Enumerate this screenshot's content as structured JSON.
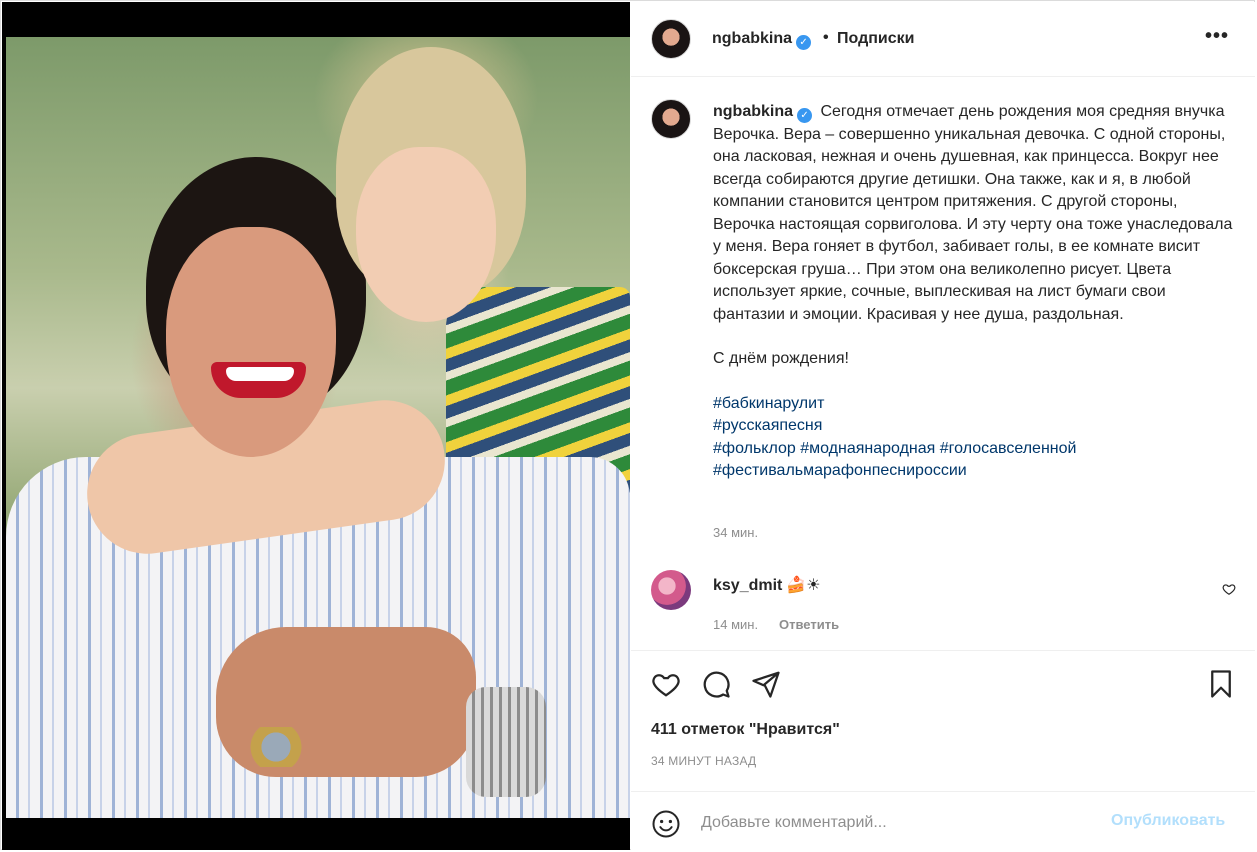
{
  "post": {
    "username": "ngbabkina",
    "follow_status": "Подписки",
    "separator": "•",
    "more_label": "•••",
    "caption_lines": [
      "Сегодня отмечает день рождения моя средняя внучка Верочка. Вера – совершенно уникальная девочка. С одной стороны, она ласковая, нежная и очень душевная, как принцесса. Вокруг нее всегда собираются другие детишки. Она также, как и я, в любой компании становится центром притяжения. С другой стороны, Верочка настоящая сорвиголова. И эту черту она тоже унаследовала у меня. Вера гоняет в футбол, забивает голы, в ее комнате висит боксерская груша… При этом она великолепно рисует. Цвета использует яркие, сочные, выплескивая на лист бумаги свои фантазии и эмоции. Красивая у нее душа, раздольная."
    ],
    "greeting": "С днём рождения!",
    "hashtags": {
      "line1": "#бабкинарулит",
      "line2": "#русскаяпесня",
      "line3a": "#фольклор",
      "line3b": "#моднаянародная",
      "line3c": "#голосавселенной",
      "line4": "#фестивальмарафонпеснироссии"
    },
    "caption_time": "34 мин.",
    "likes": "411 отметок \"Нравится\"",
    "posted_ago": "34 МИНУТ НАЗАД"
  },
  "comment": {
    "username": "ksy_dmit",
    "text": "🍰☀",
    "time": "14 мин.",
    "reply_label": "Ответить"
  },
  "comment_bar": {
    "placeholder": "Добавьте комментарий...",
    "publish_label": "Опубликовать"
  },
  "colors": {
    "text": "#262626",
    "muted": "#8e8e8e",
    "hashtag": "#00376b",
    "verified": "#3897f0",
    "publish_disabled": "#b2dffc"
  },
  "icons": {
    "verified": "verified-badge-icon",
    "more": "more-options-icon",
    "like": "heart-icon",
    "comment": "comment-bubble-icon",
    "share": "paper-plane-icon",
    "save": "bookmark-icon",
    "emoji": "smiley-icon"
  }
}
